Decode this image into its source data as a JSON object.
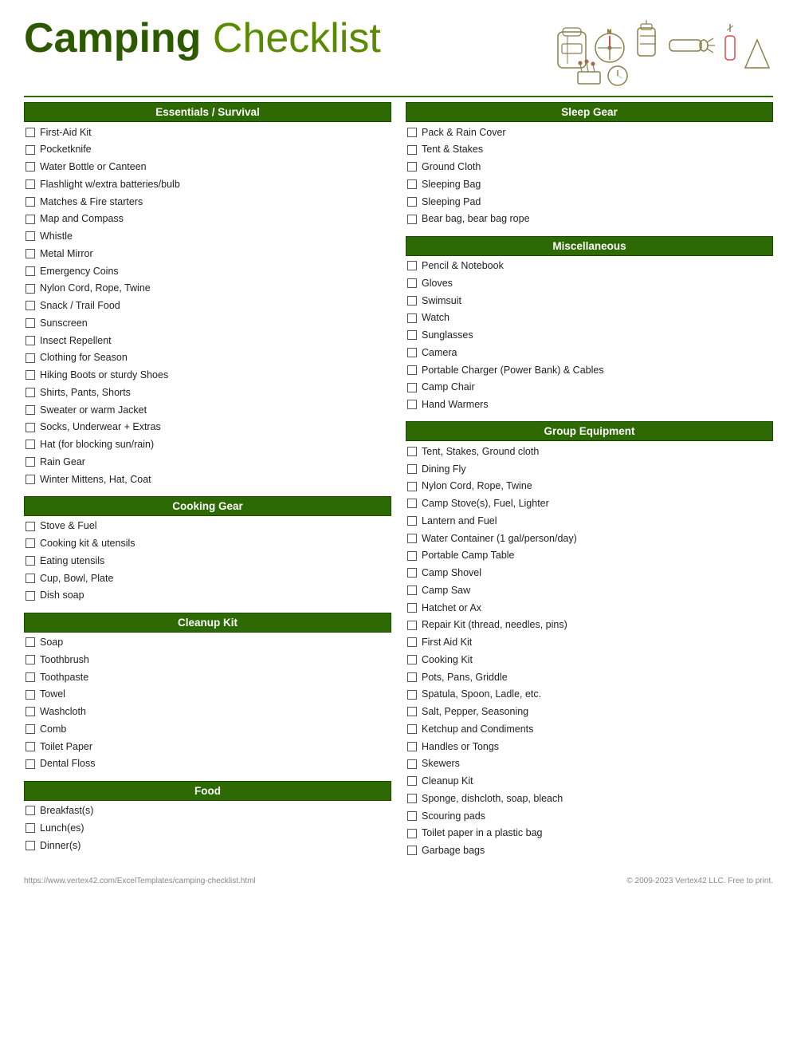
{
  "header": {
    "title_bold": "Camping",
    "title_light": "Checklist"
  },
  "footer": {
    "left": "https://www.vertex42.com/ExcelTemplates/camping-checklist.html",
    "right": "© 2009-2023 Vertex42 LLC. Free to print."
  },
  "left_column": {
    "sections": [
      {
        "id": "essentials",
        "header": "Essentials / Survival",
        "items": [
          "First-Aid Kit",
          "Pocketknife",
          "Water Bottle or Canteen",
          "Flashlight w/extra batteries/bulb",
          "Matches & Fire starters",
          "Map and Compass",
          "Whistle",
          "Metal Mirror",
          "Emergency Coins",
          "Nylon Cord, Rope, Twine",
          "Snack / Trail Food",
          "Sunscreen",
          "Insect Repellent",
          "Clothing for Season",
          "Hiking Boots or sturdy Shoes",
          "Shirts, Pants, Shorts",
          "Sweater or warm Jacket",
          "Socks, Underwear + Extras",
          "Hat (for blocking sun/rain)",
          "Rain Gear",
          "Winter Mittens, Hat, Coat"
        ]
      },
      {
        "id": "cooking",
        "header": "Cooking Gear",
        "items": [
          "Stove & Fuel",
          "Cooking kit & utensils",
          "Eating utensils",
          "Cup, Bowl, Plate",
          "Dish soap"
        ]
      },
      {
        "id": "cleanup",
        "header": "Cleanup Kit",
        "items": [
          "Soap",
          "Toothbrush",
          "Toothpaste",
          "Towel",
          "Washcloth",
          "Comb",
          "Toilet Paper",
          "Dental Floss"
        ]
      },
      {
        "id": "food",
        "header": "Food",
        "items": [
          "Breakfast(s)",
          "Lunch(es)",
          "Dinner(s)"
        ]
      }
    ]
  },
  "right_column": {
    "sections": [
      {
        "id": "sleep",
        "header": "Sleep Gear",
        "items": [
          "Pack & Rain Cover",
          "Tent & Stakes",
          "Ground Cloth",
          "Sleeping Bag",
          "Sleeping Pad",
          "Bear bag, bear bag rope"
        ]
      },
      {
        "id": "misc",
        "header": "Miscellaneous",
        "items": [
          "Pencil & Notebook",
          "Gloves",
          "Swimsuit",
          "Watch",
          "Sunglasses",
          "Camera",
          "Portable Charger (Power Bank) & Cables",
          "Camp Chair",
          "Hand Warmers"
        ]
      },
      {
        "id": "group",
        "header": "Group Equipment",
        "items": [
          "Tent, Stakes, Ground cloth",
          "Dining Fly",
          "Nylon Cord, Rope, Twine",
          "Camp Stove(s), Fuel, Lighter",
          "Lantern and Fuel",
          "Water Container (1 gal/person/day)",
          "Portable Camp Table",
          "Camp Shovel",
          "Camp Saw",
          "Hatchet or Ax",
          "Repair Kit (thread, needles, pins)",
          "First Aid Kit",
          "Cooking Kit",
          "Pots, Pans, Griddle",
          "Spatula, Spoon, Ladle, etc.",
          "Salt, Pepper, Seasoning",
          "Ketchup and Condiments",
          "Handles or Tongs",
          "Skewers",
          "Cleanup Kit",
          "Sponge, dishcloth, soap, bleach",
          "Scouring pads",
          "Toilet paper in a plastic bag",
          "Garbage bags"
        ]
      }
    ]
  }
}
